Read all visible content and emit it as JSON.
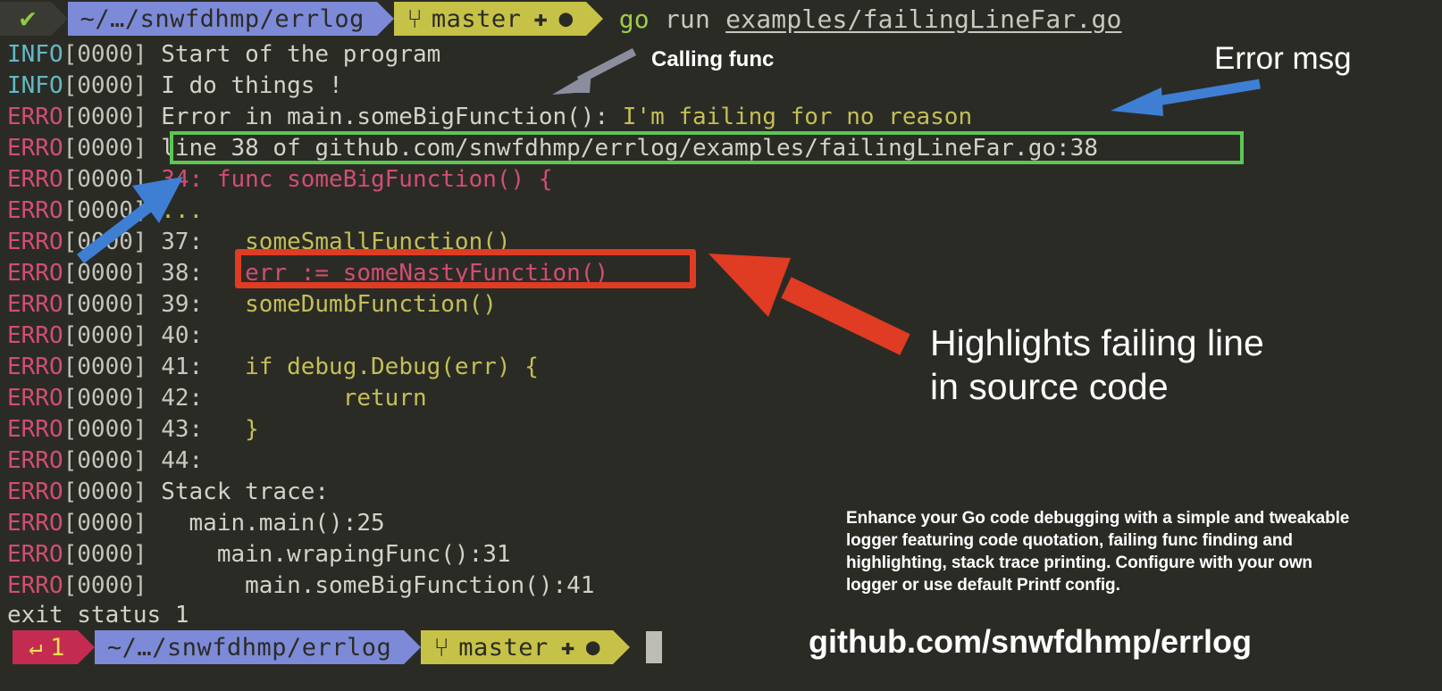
{
  "terminal": {
    "background_color": "#2b2b26",
    "prompt_top": {
      "status_icon": "check-icon",
      "status_glyph": "✔",
      "path": "~/…/snwfdhmp/errlog",
      "git_icon": "git-branch-icon",
      "git_glyph": "⑂",
      "branch": "master",
      "git_dirty_glyph": "✚",
      "git_dot_glyph": "●",
      "command_keyword": "go",
      "command_rest": " run ",
      "command_arg": "examples/failingLineFar.go"
    },
    "prompt_bottom": {
      "exit_icon": "return-arrow-icon",
      "exit_glyph": "↵",
      "exit_code": "1",
      "path": "~/…/snwfdhmp/errlog",
      "git_icon": "git-branch-icon",
      "git_glyph": "⑂",
      "branch": "master",
      "git_dirty_glyph": "✚",
      "git_dot_glyph": "●"
    },
    "exit_status": "exit status 1",
    "lines": [
      {
        "level": "INFO",
        "ts": "[0000]",
        "segments": [
          {
            "text": " Start of the program",
            "style": "plain"
          }
        ]
      },
      {
        "level": "INFO",
        "ts": "[0000]",
        "segments": [
          {
            "text": " I do things !",
            "style": "plain"
          }
        ]
      },
      {
        "level": "ERRO",
        "ts": "[0000]",
        "segments": [
          {
            "text": " Error in main.someBigFunction(): ",
            "style": "plain"
          },
          {
            "text": "I'm failing for no reason",
            "style": "err"
          }
        ]
      },
      {
        "level": "ERRO",
        "ts": "[0000]",
        "segments": [
          {
            "text": " line 38 of github.com/snwfdhmp/errlog/examples/failingLineFar.go:38",
            "style": "plain"
          }
        ]
      },
      {
        "level": "ERRO",
        "ts": "[0000]",
        "segments": [
          {
            "text": " 34: func someBigFunction() {",
            "style": "code-hl"
          }
        ]
      },
      {
        "level": "ERRO",
        "ts": "[0000]",
        "segments": [
          {
            "text": " ...",
            "style": "code"
          }
        ]
      },
      {
        "level": "ERRO",
        "ts": "[0000]",
        "segments": [
          {
            "text": " 37:",
            "style": "num"
          },
          {
            "text": "   someSmallFunction()",
            "style": "code"
          }
        ]
      },
      {
        "level": "ERRO",
        "ts": "[0000]",
        "segments": [
          {
            "text": " 38:",
            "style": "num"
          },
          {
            "text": "   err := someNastyFunction()",
            "style": "code-hl"
          }
        ]
      },
      {
        "level": "ERRO",
        "ts": "[0000]",
        "segments": [
          {
            "text": " 39:",
            "style": "num"
          },
          {
            "text": "   someDumbFunction()",
            "style": "code"
          }
        ]
      },
      {
        "level": "ERRO",
        "ts": "[0000]",
        "segments": [
          {
            "text": " 40:",
            "style": "num"
          }
        ]
      },
      {
        "level": "ERRO",
        "ts": "[0000]",
        "segments": [
          {
            "text": " 41:",
            "style": "num"
          },
          {
            "text": "   if debug.Debug(err) {",
            "style": "code"
          }
        ]
      },
      {
        "level": "ERRO",
        "ts": "[0000]",
        "segments": [
          {
            "text": " 42:",
            "style": "num"
          },
          {
            "text": "          return",
            "style": "code"
          }
        ]
      },
      {
        "level": "ERRO",
        "ts": "[0000]",
        "segments": [
          {
            "text": " 43:",
            "style": "num"
          },
          {
            "text": "   }",
            "style": "code"
          }
        ]
      },
      {
        "level": "ERRO",
        "ts": "[0000]",
        "segments": [
          {
            "text": " 44:",
            "style": "num"
          }
        ]
      },
      {
        "level": "ERRO",
        "ts": "[0000]",
        "segments": [
          {
            "text": " Stack trace:",
            "style": "plain"
          }
        ]
      },
      {
        "level": "ERRO",
        "ts": "[0000]",
        "segments": [
          {
            "text": "   main.main():25",
            "style": "plain"
          }
        ]
      },
      {
        "level": "ERRO",
        "ts": "[0000]",
        "segments": [
          {
            "text": "     main.wrapingFunc():31",
            "style": "plain"
          }
        ]
      },
      {
        "level": "ERRO",
        "ts": "[0000]",
        "segments": [
          {
            "text": "       main.someBigFunction():41",
            "style": "plain"
          }
        ]
      }
    ]
  },
  "annotations": {
    "calling_func": "Calling func",
    "error_msg": "Error msg",
    "highlights": "Highlights failing line\nin source code",
    "description": "Enhance your Go code debugging with a simple and tweakable\nlogger featuring code quotation, failing func finding and\nhighlighting, stack trace printing. Configure with your own\nlogger or use default Printf config.",
    "repo": "github.com/snwfdhmp/errlog"
  },
  "colors": {
    "green_box": "#5ec654",
    "red_box": "#e03b23",
    "blue_arrow": "#3e7fd4",
    "gray_arrow": "#8a8d9c",
    "info": "#63b9c4",
    "erro": "#d14e72",
    "err_msg": "#c4bf56",
    "path_segment": "#7d8ad8",
    "git_segment": "#c6c247",
    "fail_segment": "#c32b51"
  }
}
